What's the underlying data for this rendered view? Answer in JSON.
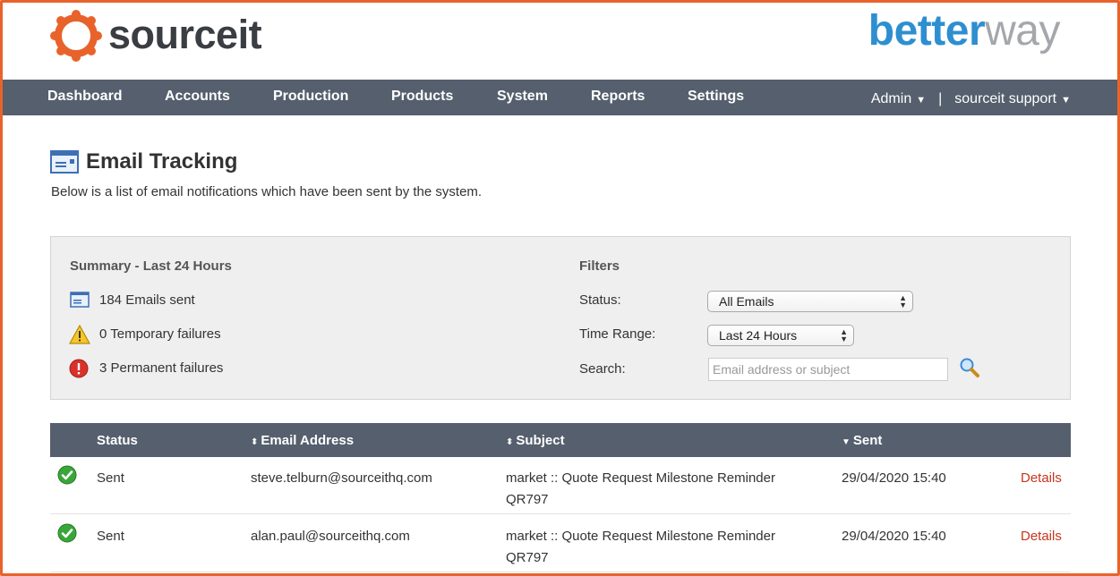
{
  "brand": {
    "name": "sourceit",
    "partner_1": "better",
    "partner_2": "way"
  },
  "nav": {
    "items": [
      "Dashboard",
      "Accounts",
      "Production",
      "Products",
      "System",
      "Reports",
      "Settings"
    ],
    "admin": "Admin",
    "separator": "|",
    "user": "sourceit support"
  },
  "page": {
    "title": "Email Tracking",
    "description": "Below is a list of email notifications which have been sent by the system."
  },
  "summary": {
    "heading": "Summary - Last 24 Hours",
    "sent": "184 Emails sent",
    "temporary": "0 Temporary failures",
    "permanent": "3 Permanent failures"
  },
  "filters": {
    "heading": "Filters",
    "status_label": "Status:",
    "status_value": "All Emails",
    "time_label": "Time Range:",
    "time_value": "Last 24 Hours",
    "search_label": "Search:",
    "search_placeholder": "Email address or subject"
  },
  "table": {
    "headers": {
      "status": "Status",
      "email": "Email Address",
      "subject": "Subject",
      "sent": "Sent"
    },
    "rows": [
      {
        "status": "Sent",
        "email": "steve.telburn@sourceithq.com",
        "subject": "market :: Quote Request Milestone Reminder QR797",
        "sent": "29/04/2020 15:40",
        "action": "Details"
      },
      {
        "status": "Sent",
        "email": "alan.paul@sourceithq.com",
        "subject": "market :: Quote Request Milestone Reminder QR797",
        "sent": "29/04/2020 15:40",
        "action": "Details"
      }
    ]
  },
  "colors": {
    "accent": "#e8632b",
    "nav": "#555f6d",
    "link": "#c7361d",
    "partner_blue": "#2d8fd0"
  }
}
